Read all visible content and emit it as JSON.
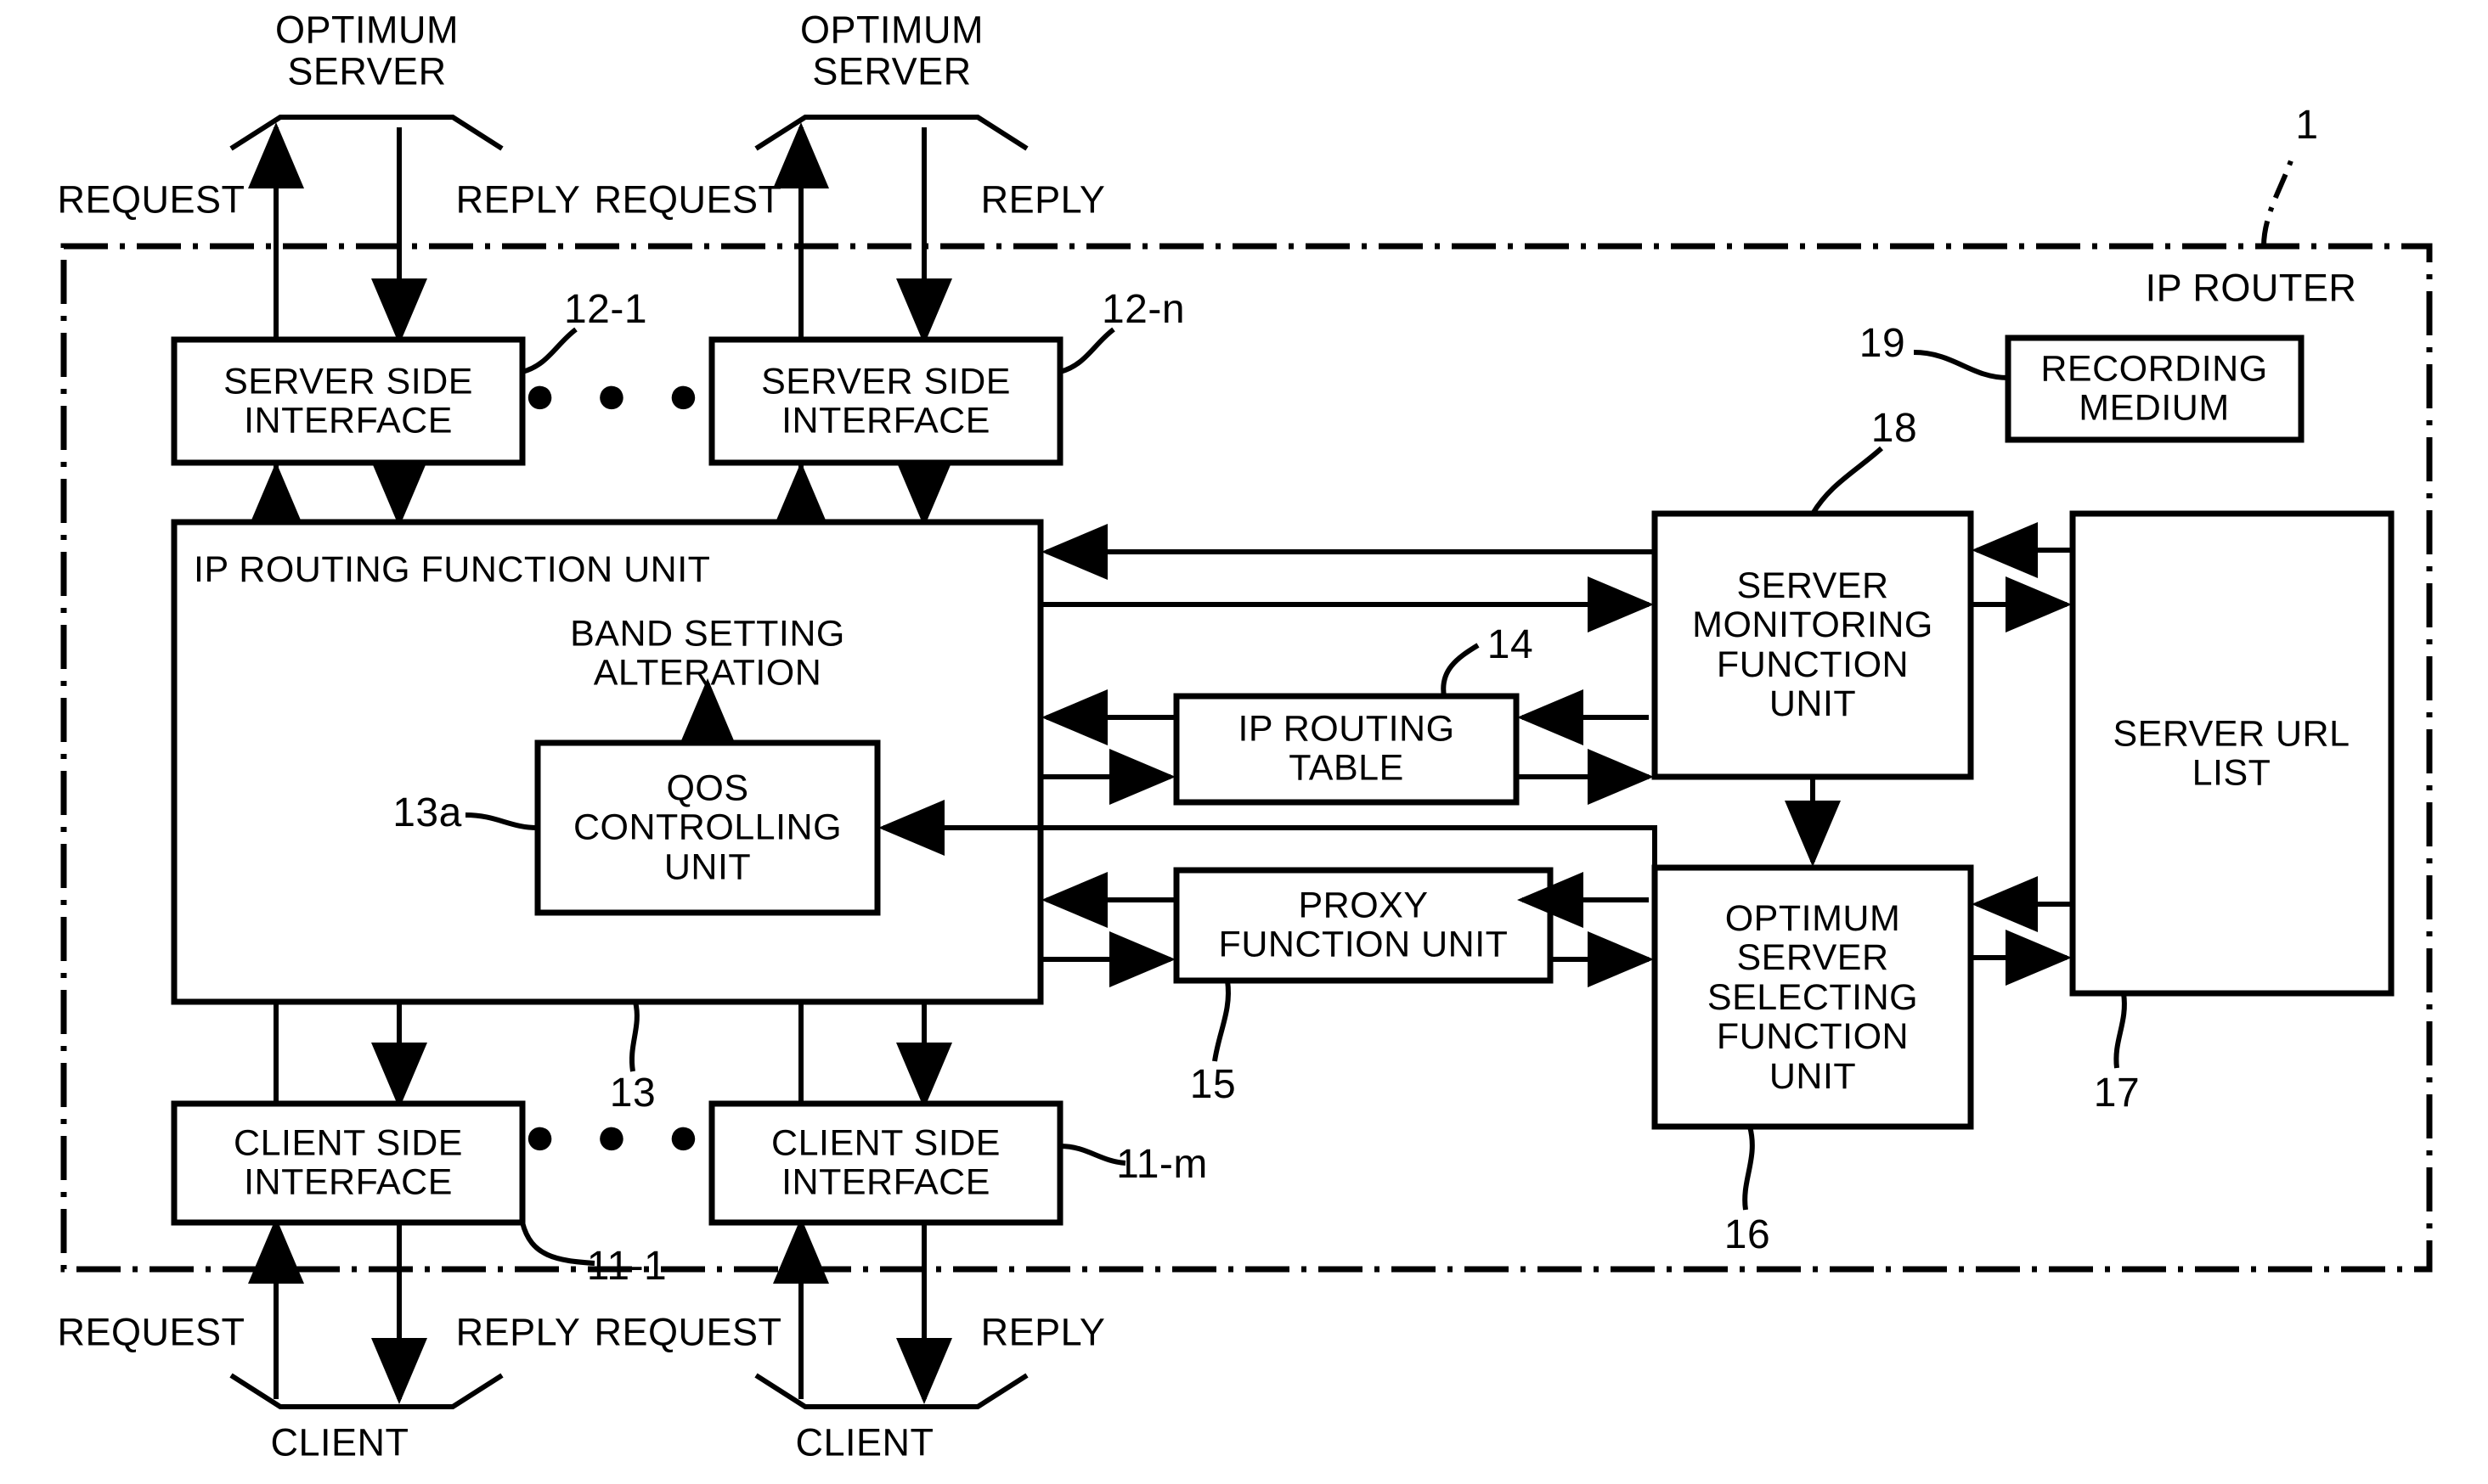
{
  "figure": {
    "title": "IP ROUTER block diagram",
    "outer_label": "IP ROUTER",
    "outer_ref": "1"
  },
  "external_nodes": [
    {
      "name": "optimum-server-1",
      "label": "OPTIMUM\nSERVER"
    },
    {
      "name": "optimum-server-n",
      "label": "OPTIMUM\nSERVER"
    },
    {
      "name": "client-1",
      "label": "CLIENT"
    },
    {
      "name": "client-m",
      "label": "CLIENT"
    }
  ],
  "flow_labels": {
    "top": [
      "REQUEST",
      "REPLY",
      "REQUEST",
      "REPLY"
    ],
    "bottom": [
      "REQUEST",
      "REPLY",
      "REQUEST",
      "REPLY"
    ]
  },
  "blocks": [
    {
      "name": "server-side-interface-1",
      "label": "SERVER SIDE\nINTERFACE",
      "ref": "12-1"
    },
    {
      "name": "server-side-interface-n",
      "label": "SERVER SIDE\nINTERFACE",
      "ref": "12-n"
    },
    {
      "name": "recording-medium",
      "label": "RECORDING\nMEDIUM",
      "ref": "19"
    },
    {
      "name": "ip-routing-function-unit",
      "label": "IP ROUTING FUNCTION UNIT",
      "ref": "13"
    },
    {
      "name": "qos-controlling-unit",
      "label": "QOS\nCONTROLLING\nUNIT",
      "ref": "13a"
    },
    {
      "name": "ip-routing-table",
      "label": "IP ROUTING\nTABLE",
      "ref": "14"
    },
    {
      "name": "proxy-function-unit",
      "label": "PROXY\nFUNCTION UNIT",
      "ref": "15"
    },
    {
      "name": "optimum-server-selecting-function-unit",
      "label": "OPTIMUM\nSERVER\nSELECTING\nFUNCTION\nUNIT",
      "ref": "16"
    },
    {
      "name": "server-url-list",
      "label": "SERVER URL\nLIST",
      "ref": "17"
    },
    {
      "name": "server-monitoring-function-unit",
      "label": "SERVER\nMONITORING\nFUNCTION\nUNIT",
      "ref": "18"
    },
    {
      "name": "client-side-interface-1",
      "label": "CLIENT SIDE\nINTERFACE",
      "ref": "11-1"
    },
    {
      "name": "client-side-interface-m",
      "label": "CLIENT SIDE\nINTERFACE",
      "ref": "11-m"
    }
  ],
  "annotations": {
    "band_setting_alteration": "BAND SETTING\nALTERATION",
    "ellipsis": "● ● ●"
  },
  "colors": {
    "ink": "#000000",
    "paper": "#ffffff"
  }
}
